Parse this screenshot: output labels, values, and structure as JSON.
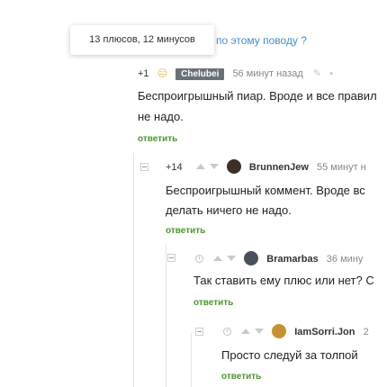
{
  "tooltip": {
    "text": "13 плюсов, 12 минусов"
  },
  "topic_link": {
    "text": "по этому поводу ?"
  },
  "comments": [
    {
      "score": "+1",
      "author": "Chelubei",
      "time": "56 минут назад",
      "text_lines": [
        "Беспроигрышный пиар. Вроде и все правил",
        "не надо."
      ],
      "reply": "ответить"
    },
    {
      "score": "+14",
      "author": "BrunnenJew",
      "time": "55 минут н",
      "text_lines": [
        "Беспроигрышный коммент. Вроде вс",
        "делать ничего не надо."
      ],
      "reply": "ответить"
    },
    {
      "score": "",
      "author": "Bramarbas",
      "time": "36 мину",
      "text_lines": [
        "Так ставить ему плюс или нет? С"
      ],
      "reply": "ответить"
    },
    {
      "score": "",
      "author": "IamSorri.Jon",
      "time": "2",
      "text_lines": [
        "Просто следуй за толпой"
      ],
      "reply": "ответить"
    }
  ],
  "colors": {
    "reply_green": "#4a9a2e",
    "link_blue": "#3f8fd6",
    "badge_gray": "#6a7077"
  }
}
